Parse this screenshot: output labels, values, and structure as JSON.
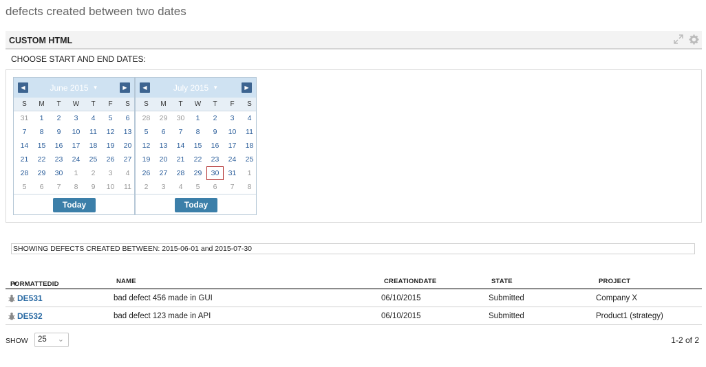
{
  "page_title": "defects created between two dates",
  "app": {
    "title": "CUSTOM HTML",
    "icons": [
      "expand-icon",
      "gear-icon"
    ]
  },
  "choose_label": "CHOOSE START AND END DATES:",
  "calendars": [
    {
      "month": "June 2015",
      "days_of_week": [
        "S",
        "M",
        "T",
        "W",
        "T",
        "F",
        "S"
      ],
      "weeks": [
        [
          "31",
          "1",
          "2",
          "3",
          "4",
          "5",
          "6"
        ],
        [
          "7",
          "8",
          "9",
          "10",
          "11",
          "12",
          "13"
        ],
        [
          "14",
          "15",
          "16",
          "17",
          "18",
          "19",
          "20"
        ],
        [
          "21",
          "22",
          "23",
          "24",
          "25",
          "26",
          "27"
        ],
        [
          "28",
          "29",
          "30",
          "1",
          "2",
          "3",
          "4"
        ],
        [
          "5",
          "6",
          "7",
          "8",
          "9",
          "10",
          "11"
        ]
      ],
      "other_month": [
        [
          0,
          0
        ],
        [
          4,
          3
        ],
        [
          4,
          4
        ],
        [
          4,
          5
        ],
        [
          4,
          6
        ],
        [
          5,
          0
        ],
        [
          5,
          1
        ],
        [
          5,
          2
        ],
        [
          5,
          3
        ],
        [
          5,
          4
        ],
        [
          5,
          5
        ],
        [
          5,
          6
        ]
      ],
      "selected": null,
      "today_label": "Today"
    },
    {
      "month": "July 2015",
      "days_of_week": [
        "S",
        "M",
        "T",
        "W",
        "T",
        "F",
        "S"
      ],
      "weeks": [
        [
          "28",
          "29",
          "30",
          "1",
          "2",
          "3",
          "4"
        ],
        [
          "5",
          "6",
          "7",
          "8",
          "9",
          "10",
          "11"
        ],
        [
          "12",
          "13",
          "14",
          "15",
          "16",
          "17",
          "18"
        ],
        [
          "19",
          "20",
          "21",
          "22",
          "23",
          "24",
          "25"
        ],
        [
          "26",
          "27",
          "28",
          "29",
          "30",
          "31",
          "1"
        ],
        [
          "2",
          "3",
          "4",
          "5",
          "6",
          "7",
          "8"
        ]
      ],
      "other_month": [
        [
          0,
          0
        ],
        [
          0,
          1
        ],
        [
          0,
          2
        ],
        [
          4,
          6
        ],
        [
          5,
          0
        ],
        [
          5,
          1
        ],
        [
          5,
          2
        ],
        [
          5,
          3
        ],
        [
          5,
          4
        ],
        [
          5,
          5
        ],
        [
          5,
          6
        ]
      ],
      "selected": [
        4,
        4
      ],
      "today_label": "Today"
    }
  ],
  "showing_text": "SHOWING DEFECTS CREATED BETWEEN: 2015-06-01 and 2015-07-30",
  "table": {
    "columns": [
      "FORMATTEDID",
      "NAME",
      "CREATIONDATE",
      "STATE",
      "PROJECT"
    ],
    "sort_indicator": "▼",
    "rows": [
      {
        "id": "DE531",
        "name": "bad defect 456 made in GUI",
        "creation_date": "06/10/2015",
        "state": "Submitted",
        "project": "Company X"
      },
      {
        "id": "DE532",
        "name": "bad defect 123 made in API",
        "creation_date": "06/10/2015",
        "state": "Submitted",
        "project": "Product1 (strategy)"
      }
    ]
  },
  "pager": {
    "show_label": "SHOW",
    "page_size": "25",
    "range_text": "1-2 of 2"
  },
  "colors": {
    "link": "#2a6aa3",
    "calendar_header": "#cfe2f2",
    "nav_button": "#3d6490",
    "today_button": "#3c7fa9",
    "selected_border": "#b02a2a"
  }
}
